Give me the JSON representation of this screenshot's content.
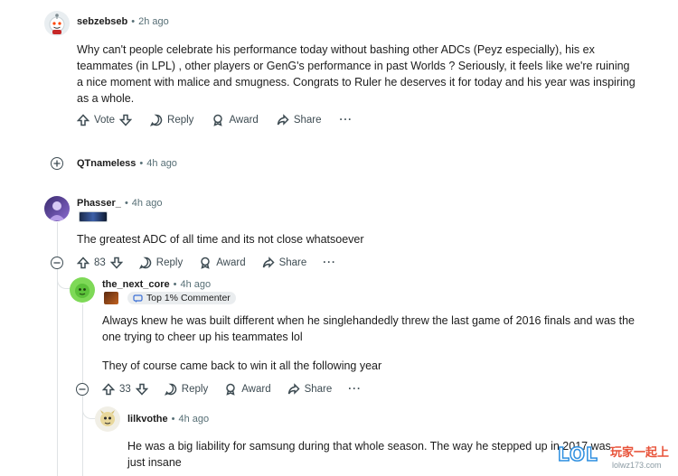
{
  "comments": [
    {
      "username": "sebzebseb",
      "time": "2h ago",
      "body": "Why can't people celebrate his performance today without bashing other ADCs (Peyz especially), his ex teammates (in LPL) , other players or GenG's performance in past Worlds ? Seriously, it feels like we're ruining a nice moment with malice and smugness. Congrats to Ruler he deserves it for today and his year was inspiring as a whole.",
      "vote_label": "Vote",
      "reply_label": "Reply",
      "award_label": "Award",
      "share_label": "Share",
      "more": "···"
    },
    {
      "username": "QTnameless",
      "time": "4h ago"
    },
    {
      "username": "Phasser_",
      "time": "4h ago",
      "body": "The greatest ADC of all time and its not close whatsoever",
      "score": "83",
      "reply_label": "Reply",
      "award_label": "Award",
      "share_label": "Share",
      "more": "···"
    },
    {
      "username": "the_next_core",
      "time": "4h ago",
      "badge": "Top 1% Commenter",
      "body1": "Always knew he was built different when he singlehandedly threw the last game of 2016 finals and was the one trying to cheer up his teammates lol",
      "body2": "They of course came back to win it all the following year",
      "score": "33",
      "reply_label": "Reply",
      "award_label": "Award",
      "share_label": "Share",
      "more": "···"
    },
    {
      "username": "lilkvothe",
      "time": "4h ago",
      "body": "He was a big liability for samsung during that whole season. The way he stepped up in 2017 was just insane"
    }
  ],
  "separator": "•",
  "watermark": {
    "logo": "LOL",
    "text": "玩家一起上",
    "url": "lolwz173.com"
  },
  "colors": {
    "text": "#1c1c1c",
    "meta": "#576f76",
    "thread": "#dfe3e5",
    "badge_bg": "#eaedef"
  }
}
